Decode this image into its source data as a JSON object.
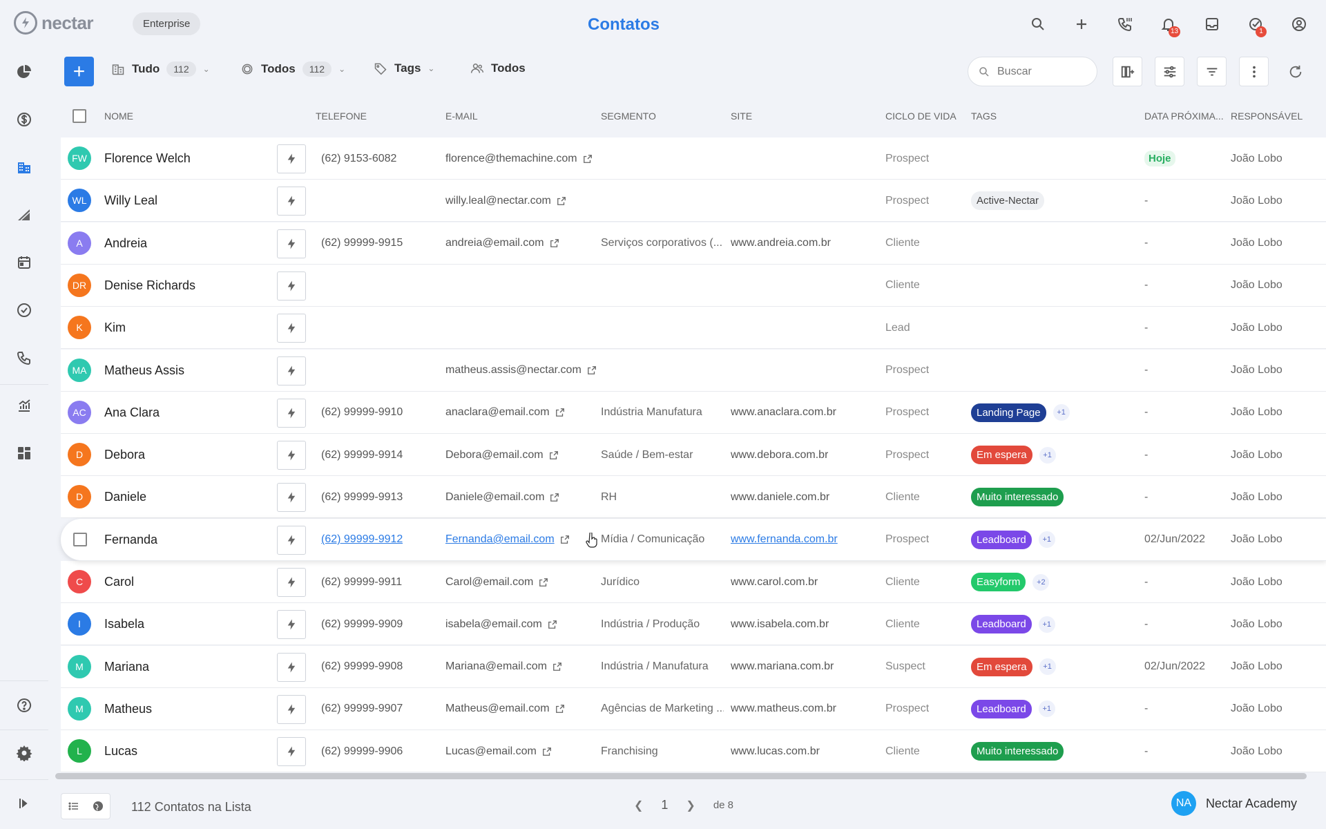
{
  "app": {
    "logo_text": "nectar",
    "plan": "Enterprise",
    "title": "Contatos"
  },
  "header_icons": [
    {
      "name": "search-icon"
    },
    {
      "name": "plus-icon"
    },
    {
      "name": "phone-icon"
    },
    {
      "name": "bell-icon",
      "badge": "13"
    },
    {
      "name": "inbox-icon"
    },
    {
      "name": "task-check-icon",
      "badge": "1"
    },
    {
      "name": "user-circle-icon"
    }
  ],
  "toolbar": {
    "add_label": "+",
    "filter_all": {
      "label": "Tudo",
      "count": "112"
    },
    "filter_status": {
      "label": "Todos",
      "count": "112"
    },
    "filter_tags": {
      "label": "Tags"
    },
    "filter_owner": {
      "label": "Todos"
    },
    "search_placeholder": "Buscar"
  },
  "columns": {
    "name": "NOME",
    "phone": "TELEFONE",
    "email": "E-MAIL",
    "segment": "SEGMENTO",
    "site": "SITE",
    "cycle": "CICLO DE VIDA",
    "tags": "TAGS",
    "next_date": "DATA PRÓXIMA...",
    "owner": "RESPONSÁVEL"
  },
  "rows": [
    {
      "initials": "FW",
      "avatar_color": "#2fc9b0",
      "name": "Florence Welch",
      "phone": "(62) 9153-6082",
      "email": "florence@themachine.com",
      "segment": "",
      "site": "",
      "cycle": "Prospect",
      "tags": [],
      "extra": "",
      "next_date": "Hoje",
      "next_is_today": true,
      "owner": "João Lobo"
    },
    {
      "initials": "WL",
      "avatar_color": "#2b7be5",
      "name": "Willy Leal",
      "phone": "",
      "email": "willy.leal@nectar.com",
      "segment": "",
      "site": "",
      "cycle": "Prospect",
      "tags": [
        {
          "label": "Active-Nectar",
          "color": "neutral"
        }
      ],
      "extra": "",
      "next_date": "-",
      "owner": "João Lobo"
    },
    {
      "initials": "A",
      "avatar_color": "#8a7cf0",
      "name": "Andreia",
      "phone": "(62) 99999-9915",
      "email": "andreia@email.com",
      "segment": "Serviços corporativos (...",
      "site": "www.andreia.com.br",
      "cycle": "Cliente",
      "tags": [],
      "extra": "",
      "next_date": "-",
      "owner": "João Lobo"
    },
    {
      "initials": "DR",
      "avatar_color": "#f5761e",
      "name": "Denise Richards",
      "phone": "",
      "email": "",
      "segment": "",
      "site": "",
      "cycle": "Cliente",
      "tags": [],
      "extra": "",
      "next_date": "-",
      "owner": "João Lobo"
    },
    {
      "initials": "K",
      "avatar_color": "#f5761e",
      "name": "Kim",
      "phone": "",
      "email": "",
      "segment": "",
      "site": "",
      "cycle": "Lead",
      "tags": [],
      "extra": "",
      "next_date": "-",
      "owner": "João Lobo"
    },
    {
      "initials": "MA",
      "avatar_color": "#2fc9b0",
      "name": "Matheus Assis",
      "phone": "",
      "email": "matheus.assis@nectar.com",
      "segment": "",
      "site": "",
      "cycle": "Prospect",
      "tags": [],
      "extra": "",
      "next_date": "-",
      "owner": "João Lobo"
    },
    {
      "initials": "AC",
      "avatar_color": "#8a7cf0",
      "name": "Ana Clara",
      "phone": "(62) 99999-9910",
      "email": "anaclara@email.com",
      "segment": "Indústria Manufatura",
      "site": "www.anaclara.com.br",
      "cycle": "Prospect",
      "tags": [
        {
          "label": "Landing Page",
          "color": "#1f3f95"
        }
      ],
      "extra": "+1",
      "next_date": "-",
      "owner": "João Lobo"
    },
    {
      "initials": "D",
      "avatar_color": "#f5761e",
      "name": "Debora",
      "phone": "(62) 99999-9914",
      "email": "Debora@email.com",
      "segment": "Saúde / Bem-estar",
      "site": "www.debora.com.br",
      "cycle": "Prospect",
      "tags": [
        {
          "label": "Em espera",
          "color": "#e2493b"
        }
      ],
      "extra": "+1",
      "next_date": "-",
      "owner": "João Lobo"
    },
    {
      "initials": "D",
      "avatar_color": "#f5761e",
      "name": "Daniele",
      "phone": "(62) 99999-9913",
      "email": "Daniele@email.com",
      "segment": "RH",
      "site": "www.daniele.com.br",
      "cycle": "Cliente",
      "tags": [
        {
          "label": "Muito interessado",
          "color": "#1e9e4e"
        }
      ],
      "extra": "",
      "next_date": "-",
      "owner": "João Lobo"
    },
    {
      "initials": "",
      "avatar_color": "",
      "name": "Fernanda",
      "phone": "(62) 99999-9912",
      "email": "Fernanda@email.com",
      "segment": "Mídia / Comunicação",
      "site": "www.fernanda.com.br",
      "cycle": "Prospect",
      "tags": [
        {
          "label": "Leadboard",
          "color": "#7b48e8"
        }
      ],
      "extra": "+1",
      "next_date": "02/Jun/2022",
      "owner": "João Lobo",
      "hover": true
    },
    {
      "initials": "C",
      "avatar_color": "#ef4b4b",
      "name": "Carol",
      "phone": "(62) 99999-9911",
      "email": "Carol@email.com",
      "segment": "Jurídico",
      "site": "www.carol.com.br",
      "cycle": "Cliente",
      "tags": [
        {
          "label": "Easyform",
          "color": "#23c96b"
        }
      ],
      "extra": "+2",
      "next_date": "-",
      "owner": "João Lobo"
    },
    {
      "initials": "I",
      "avatar_color": "#2b7be5",
      "name": "Isabela",
      "phone": "(62) 99999-9909",
      "email": "isabela@email.com",
      "segment": "Indústria / Produção",
      "site": "www.isabela.com.br",
      "cycle": "Cliente",
      "tags": [
        {
          "label": "Leadboard",
          "color": "#7b48e8"
        }
      ],
      "extra": "+1",
      "next_date": "-",
      "owner": "João Lobo"
    },
    {
      "initials": "M",
      "avatar_color": "#2fc9b0",
      "name": "Mariana",
      "phone": "(62) 99999-9908",
      "email": "Mariana@email.com",
      "segment": "Indústria / Manufatura",
      "site": "www.mariana.com.br",
      "cycle": "Suspect",
      "tags": [
        {
          "label": "Em espera",
          "color": "#e2493b"
        }
      ],
      "extra": "+1",
      "next_date": "02/Jun/2022",
      "owner": "João Lobo"
    },
    {
      "initials": "M",
      "avatar_color": "#2fc9b0",
      "name": "Matheus",
      "phone": "(62) 99999-9907",
      "email": "Matheus@email.com",
      "segment": "Agências de Marketing ...",
      "site": "www.matheus.com.br",
      "cycle": "Prospect",
      "tags": [
        {
          "label": "Leadboard",
          "color": "#7b48e8"
        }
      ],
      "extra": "+1",
      "next_date": "-",
      "owner": "João Lobo"
    },
    {
      "initials": "L",
      "avatar_color": "#22b24c",
      "name": "Lucas",
      "phone": "(62) 99999-9906",
      "email": "Lucas@email.com",
      "segment": "Franchising",
      "site": "www.lucas.com.br",
      "cycle": "Cliente",
      "tags": [
        {
          "label": "Muito interessado",
          "color": "#1e9e4e"
        }
      ],
      "extra": "",
      "next_date": "-",
      "owner": "João Lobo"
    }
  ],
  "footer": {
    "count_label": "112 Contatos na Lista",
    "page": "1",
    "of_label": "de 8",
    "user_initials": "NA",
    "user_name": "Nectar Academy"
  }
}
